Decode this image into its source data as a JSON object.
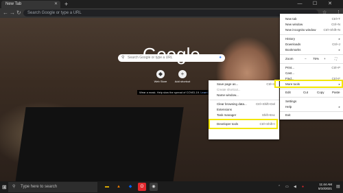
{
  "tab": {
    "title": "New Tab",
    "close": "✕"
  },
  "newtab_symbol": "+",
  "window_controls": [
    "—",
    "☐",
    "✕"
  ],
  "nav": {
    "back": "←",
    "forward": "→",
    "reload": "↻"
  },
  "omnibox": {
    "placeholder": "Search Google or type a URL"
  },
  "toolbar_icons": [
    "☆",
    "⋮"
  ],
  "page": {
    "logo": "Google",
    "search_placeholder": "Search Google or type a URL",
    "shortcuts": [
      {
        "label": "Web Store",
        "icon": "store-icon",
        "glyph": "◆"
      },
      {
        "label": "Add shortcut",
        "icon": "plus-icon",
        "glyph": "+"
      }
    ],
    "covid_notice": {
      "text": "Wear a mask. Help slow the spread of COVID-19.",
      "link": "Learn more"
    }
  },
  "more_tools_menu": {
    "items": [
      {
        "label": "Save page as...",
        "shortcut": "Ctrl+S",
        "disabled": false
      },
      {
        "label": "Create shortcut...",
        "shortcut": "",
        "disabled": true
      },
      {
        "label": "Name window...",
        "shortcut": "",
        "disabled": false
      },
      {
        "label": "Clear browsing data...",
        "shortcut": "Ctrl+Shift+Del",
        "disabled": false
      },
      {
        "label": "Extensions",
        "shortcut": "",
        "disabled": false
      },
      {
        "label": "Task manager",
        "shortcut": "Shift+Esc",
        "disabled": false
      },
      {
        "label": "Developer tools",
        "shortcut": "Ctrl+Shift+I",
        "disabled": false
      }
    ]
  },
  "main_menu": {
    "items": [
      {
        "label": "New tab",
        "shortcut": "Ctrl+T"
      },
      {
        "label": "New window",
        "shortcut": "Ctrl+N"
      },
      {
        "label": "New incognito window",
        "shortcut": "Ctrl+Shift+N"
      },
      {
        "label": "History",
        "shortcut": "▸"
      },
      {
        "label": "Downloads",
        "shortcut": "Ctrl+J"
      },
      {
        "label": "Bookmarks",
        "shortcut": "▸"
      },
      {
        "label": "Print...",
        "shortcut": "Ctrl+P"
      },
      {
        "label": "Cast...",
        "shortcut": ""
      },
      {
        "label": "Find...",
        "shortcut": "Ctrl+F"
      },
      {
        "label": "More tools",
        "shortcut": "▸"
      },
      {
        "label": "Settings",
        "shortcut": ""
      },
      {
        "label": "Help",
        "shortcut": "▸"
      },
      {
        "label": "Exit",
        "shortcut": ""
      }
    ],
    "zoom": {
      "label": "Zoom",
      "minus": "−",
      "value": "75%",
      "plus": "+",
      "full": "⛶"
    },
    "edit": {
      "label": "Edit",
      "cut": "Cut",
      "copy": "Copy",
      "paste": "Paste"
    }
  },
  "taskbar": {
    "start": "⊞",
    "search_placeholder": "Type here to search",
    "apps": [
      {
        "name": "file-explorer-icon",
        "glyph": "▬",
        "color": "#e8b400"
      },
      {
        "name": "vlc-icon",
        "glyph": "▲",
        "color": "#f07c00"
      },
      {
        "name": "dropbox-icon",
        "glyph": "◆",
        "color": "#0061fe"
      },
      {
        "name": "opera-icon",
        "glyph": "O",
        "color": "#e0282d"
      },
      {
        "name": "chrome-icon",
        "glyph": "◉",
        "color": "#ddd"
      }
    ],
    "time": "11:44 AM",
    "date": "5/10/2021"
  },
  "colors": {
    "highlight": "#f2e600"
  }
}
